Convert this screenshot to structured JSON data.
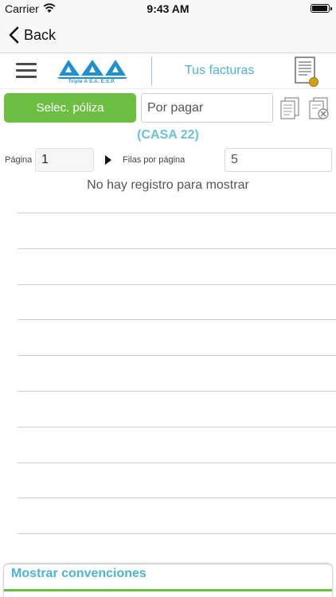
{
  "status_bar": {
    "carrier": "Carrier",
    "time": "9:43 AM"
  },
  "nav": {
    "back_label": "Back"
  },
  "header": {
    "logo_text": "Triple A S.A. E.S.P.",
    "title": "Tus facturas",
    "icons": [
      "menu-icon",
      "invoice-icon"
    ]
  },
  "filters": {
    "policy_button": "Selec. póliza",
    "status_value": "Por pagar",
    "icons": [
      "document-copy-icon",
      "document-cancel-icon"
    ]
  },
  "account": {
    "label": "(CASA 22)"
  },
  "pagination": {
    "page_label": "Página",
    "page_value": "1",
    "rows_label": "Filas por página",
    "rows_value": "5"
  },
  "list": {
    "empty_message": "No hay registro para mostrar",
    "rows": []
  },
  "legend": {
    "toggle_label": "Mostrar convenciones"
  },
  "colors": {
    "accent_green": "#6cbf43",
    "accent_blue": "#4db3d4",
    "casa_blue": "#6bc1d9"
  }
}
